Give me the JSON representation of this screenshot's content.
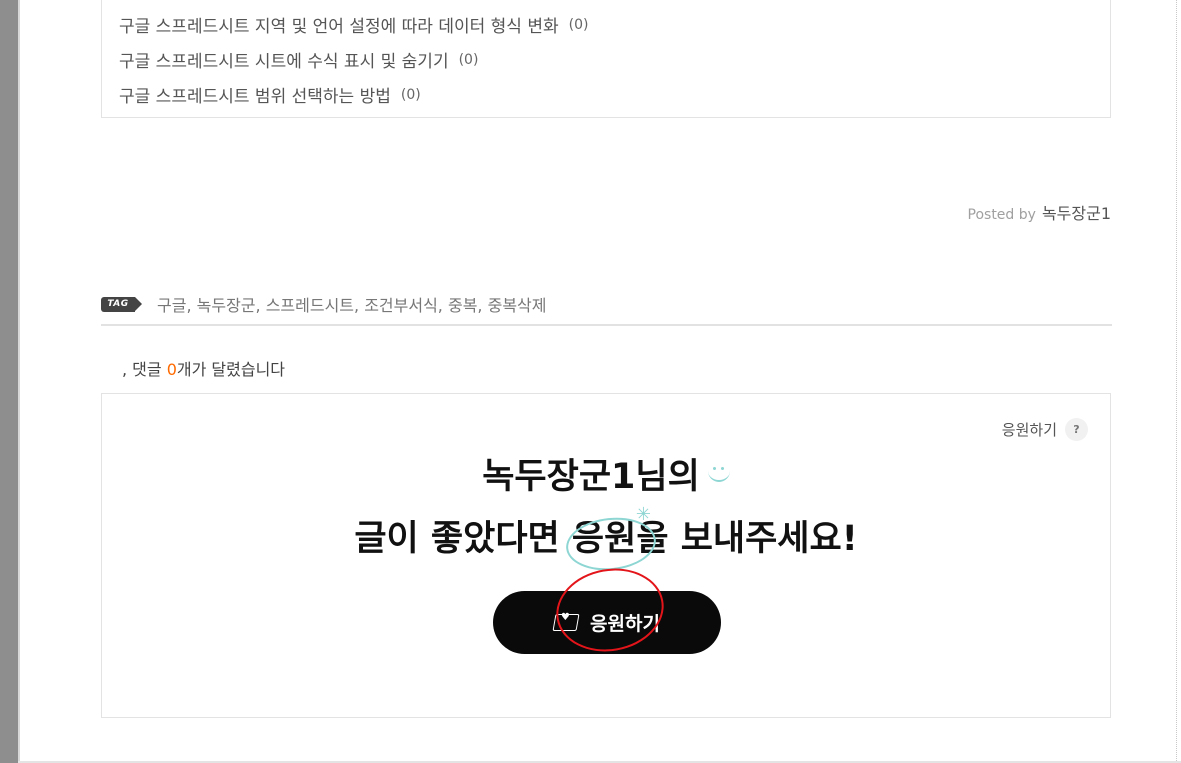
{
  "related_posts": [
    {
      "title": "구글 스프레드시트 지역 및 언어 설정에 따라 데이터 형식 변화",
      "count": "(0)"
    },
    {
      "title": "구글 스프레드시트 시트에 수식 표시 및 숨기기",
      "count": "(0)"
    },
    {
      "title": "구글 스프레드시트 범위 선택하는 방법",
      "count": "(0)"
    }
  ],
  "posted_by": {
    "label": "Posted by",
    "author": "녹두장군1"
  },
  "tags": {
    "badge": "TAG",
    "items": [
      "구글",
      "녹두장군",
      "스프레드시트",
      "조건부서식",
      "중복",
      "중복삭제"
    ],
    "separator": ", "
  },
  "comments": {
    "prefix": ", 댓글 ",
    "count": "0",
    "suffix": "개가 달렸습니다"
  },
  "support": {
    "help_label": "응원하기",
    "help_icon": "?",
    "heading_line1": "녹두장군1님의",
    "heading_line2_before": "글이 좋았다면 ",
    "heading_line2_highlight": "응원",
    "heading_line2_after": "을 보내주세요!",
    "button_label": "응원하기",
    "button_icon": "coffee-icon",
    "accent_color": "#8dd6d3"
  },
  "colors": {
    "comment_count": "#ff6a00",
    "annotation": "#e3151a",
    "button_bg": "#0a0a0a"
  }
}
